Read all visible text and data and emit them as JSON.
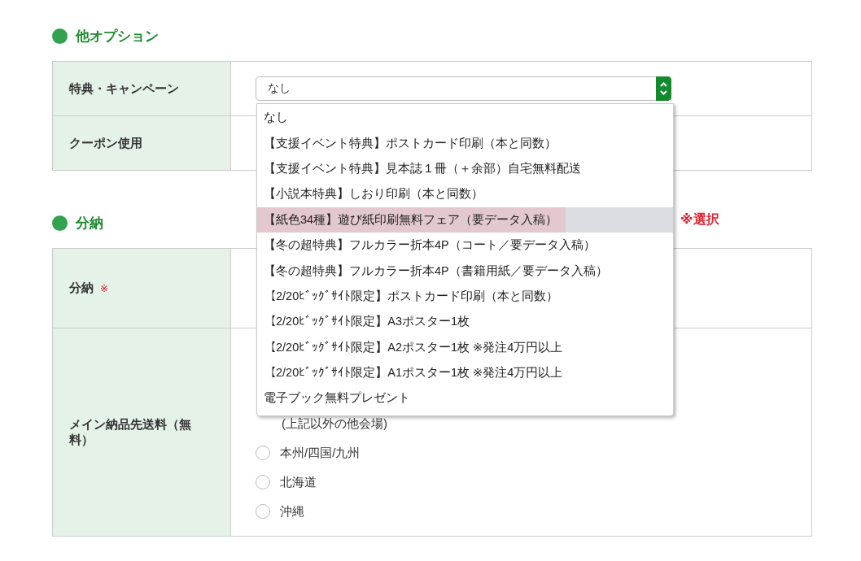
{
  "sections": [
    {
      "title": "他オプション",
      "rows": [
        {
          "label": "特典・キャンペーン",
          "kind": "select",
          "value": "なし"
        },
        {
          "label": "クーポン使用",
          "kind": "empty"
        }
      ]
    },
    {
      "title": "分納",
      "rows": [
        {
          "label": "分納",
          "required_mark": "※",
          "kind": "empty"
        },
        {
          "label": "メイン納品先送料（無料）",
          "kind": "radios",
          "note": "(上記以外の他会場)",
          "options": [
            {
              "label": "本州/四国/九州",
              "selected": false
            },
            {
              "label": "北海道",
              "selected": false
            },
            {
              "label": "沖縄",
              "selected": false
            }
          ]
        }
      ]
    }
  ],
  "dropdown": {
    "options": [
      {
        "label": "なし",
        "highlighted": false
      },
      {
        "label": "【支援イベント特典】ポストカード印刷（本と同数）",
        "highlighted": false
      },
      {
        "label": "【支援イベント特典】見本誌１冊（＋余部）自宅無料配送",
        "highlighted": false
      },
      {
        "label": "【小説本特典】しおり印刷（本と同数）",
        "highlighted": false
      },
      {
        "label": "【紙色34種】遊び紙印刷無料フェア（要データ入稿）",
        "highlighted": true
      },
      {
        "label": "【冬の超特典】フルカラー折本4P（コート／要データ入稿）",
        "highlighted": false
      },
      {
        "label": "【冬の超特典】フルカラー折本4P（書籍用紙／要データ入稿）",
        "highlighted": false
      },
      {
        "label": "【2/20ﾋﾞｯｸﾞｻｲﾄ限定】ポストカード印刷（本と同数）",
        "highlighted": false
      },
      {
        "label": "【2/20ﾋﾞｯｸﾞｻｲﾄ限定】A3ポスター1枚",
        "highlighted": false
      },
      {
        "label": "【2/20ﾋﾞｯｸﾞｻｲﾄ限定】A2ポスター1枚 ※発注4万円以上",
        "highlighted": false
      },
      {
        "label": "【2/20ﾋﾞｯｸﾞｻｲﾄ限定】A1ポスター1枚 ※発注4万円以上",
        "highlighted": false
      },
      {
        "label": "電子ブック無料プレゼント",
        "highlighted": false
      }
    ],
    "annotation": "※選択"
  }
}
